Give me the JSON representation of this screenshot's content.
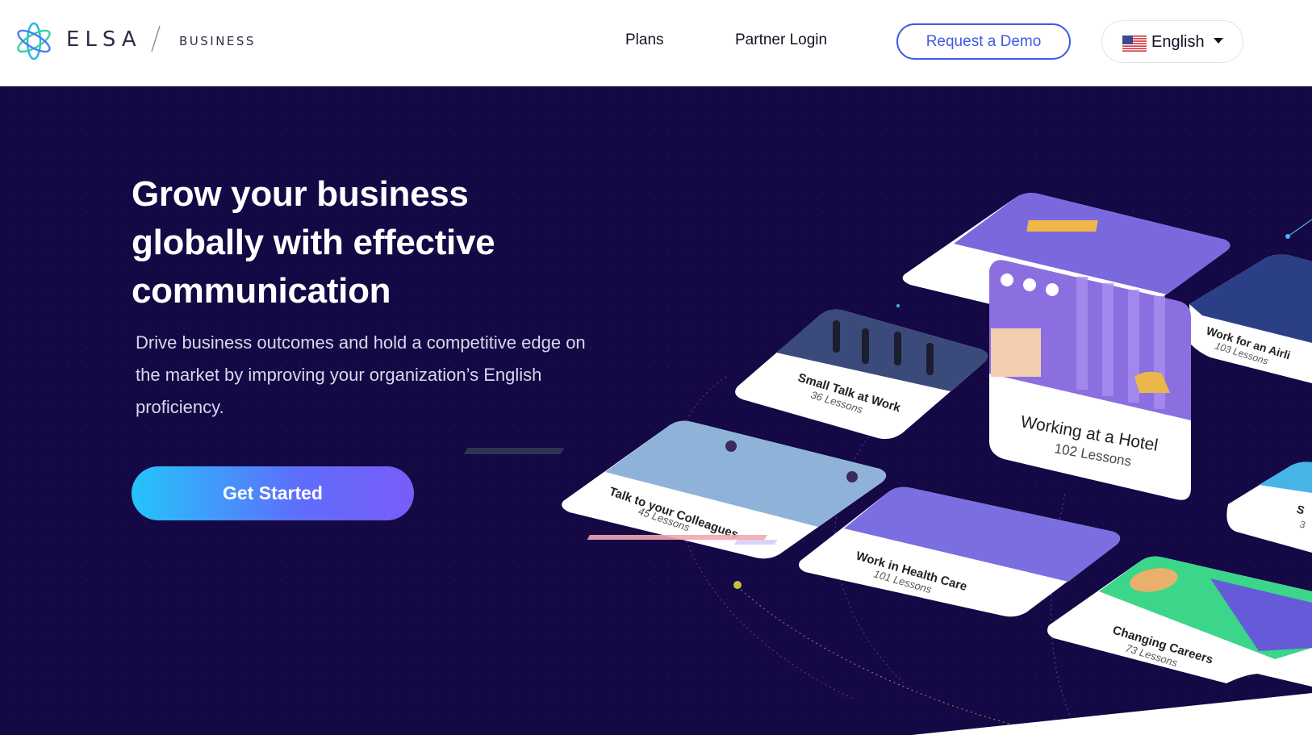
{
  "header": {
    "brand_name": "ELSA",
    "brand_sub": "BUSINESS",
    "nav": {
      "plans": "Plans",
      "partner_login": "Partner Login"
    },
    "demo_button": "Request a Demo",
    "language": {
      "selected": "English",
      "flag_icon": "us-flag-icon"
    }
  },
  "hero": {
    "title": "Grow your business globally with effective communication",
    "subtitle": "Drive business outcomes and hold a competitive edge on the market by improving your organization’s English proficiency.",
    "cta": "Get Started"
  },
  "courses": [
    {
      "title": "Working at a Hotel",
      "lessons": "102 Lessons"
    },
    {
      "title": "Small Talk at Work",
      "lessons": "36 Lessons"
    },
    {
      "title": "Talk to your Colleagues",
      "lessons": "45 Lessons"
    },
    {
      "title": "Work in Health Care",
      "lessons": "101 Lessons"
    },
    {
      "title": "Changing Careers",
      "lessons": "73 Lessons"
    },
    {
      "title": "Work for an Airli",
      "lessons": "103 Lessons"
    },
    {
      "title": "S",
      "lessons": "3"
    }
  ],
  "colors": {
    "hero_bg": "#140845",
    "accent": "#3f5be7",
    "cta_start": "#25c4fb",
    "cta_end": "#7a5cf9"
  }
}
